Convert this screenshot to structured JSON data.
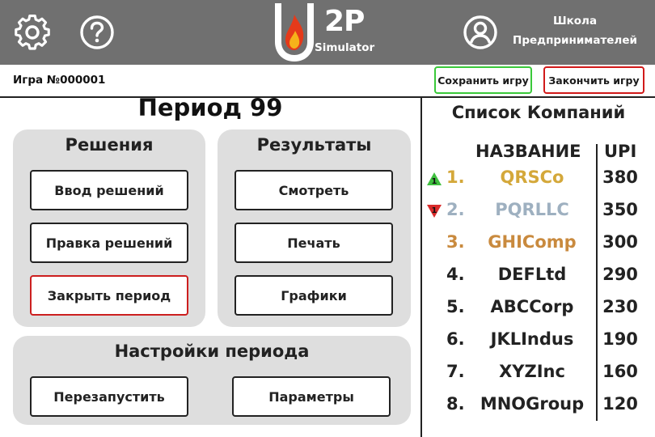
{
  "header": {
    "logo_text": "2P",
    "logo_subtext": "Simulator",
    "school_line1": "Школа",
    "school_line2": "Предпринимателей"
  },
  "subheader": {
    "game_id": "Игра №000001",
    "save_label": "Сохранить игру",
    "end_label": "Закончить игру"
  },
  "period": {
    "title": "Период 99",
    "decisions": {
      "title": "Решения",
      "enter_label": "Ввод решений",
      "edit_label": "Правка решений",
      "close_label": "Закрыть период"
    },
    "results": {
      "title": "Результаты",
      "view_label": "Смотреть",
      "print_label": "Печать",
      "charts_label": "Графики"
    },
    "settings": {
      "title": "Настройки периода",
      "restart_label": "Перезапустить",
      "params_label": "Параметры"
    }
  },
  "companies": {
    "title": "Список Компаний",
    "col_name": "НАЗВАНИЕ",
    "col_upi": "UPI",
    "rows": [
      {
        "rank": "1.",
        "name": "QRSCo",
        "upi": "380",
        "trend": "up",
        "trend_label": "1",
        "color": "#d4a83a"
      },
      {
        "rank": "2.",
        "name": "PQRLLC",
        "upi": "350",
        "trend": "down",
        "trend_label": "1",
        "color": "#9eb0c0"
      },
      {
        "rank": "3.",
        "name": "GHIComp",
        "upi": "300",
        "trend": "",
        "trend_label": "",
        "color": "#c98a3e"
      },
      {
        "rank": "4.",
        "name": "DEFLtd",
        "upi": "290",
        "trend": "",
        "trend_label": "",
        "color": "#222222"
      },
      {
        "rank": "5.",
        "name": "ABCCorp",
        "upi": "230",
        "trend": "",
        "trend_label": "",
        "color": "#222222"
      },
      {
        "rank": "6.",
        "name": "JKLIndus",
        "upi": "190",
        "trend": "",
        "trend_label": "",
        "color": "#222222"
      },
      {
        "rank": "7.",
        "name": "XYZInc",
        "upi": "160",
        "trend": "",
        "trend_label": "",
        "color": "#222222"
      },
      {
        "rank": "8.",
        "name": "MNOGroup",
        "upi": "120",
        "trend": "",
        "trend_label": "",
        "color": "#222222"
      }
    ]
  },
  "icons": {
    "settings": "gear-icon",
    "help": "help-icon",
    "profile": "user-icon",
    "up": "trend-up-icon",
    "down": "trend-down-icon"
  },
  "colors": {
    "header_bg": "#707070",
    "panel_bg": "#dedede",
    "save_border": "#3ac93a",
    "end_border": "#d11a1a",
    "trend_up": "#3fbf3f",
    "trend_down": "#d92b2b"
  }
}
